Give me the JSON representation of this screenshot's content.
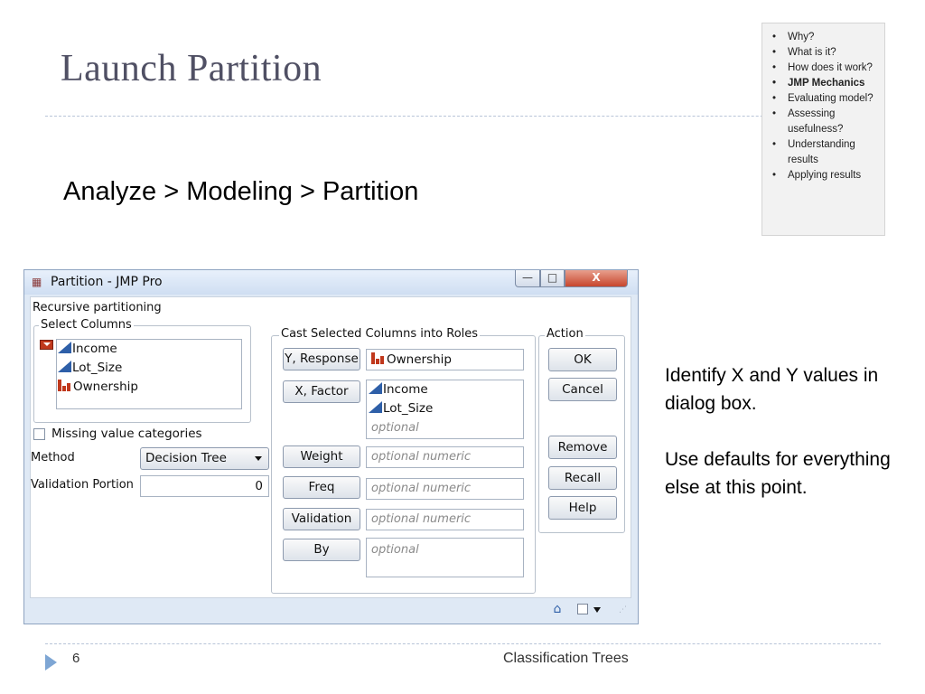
{
  "slide": {
    "title": "Launch Partition",
    "menu_path": "Analyze > Modeling > Partition",
    "notes": [
      "Identify X and Y values in dialog box.",
      "Use defaults for everything else at this point."
    ],
    "page_number": "6",
    "footer_title": "Classification Trees"
  },
  "outline": {
    "items": [
      "Why?",
      "What is it?",
      "How does it work?",
      "JMP Mechanics",
      "Evaluating model?",
      "Assessing usefulness?",
      "Understanding results",
      "Applying results"
    ],
    "active_index": 3
  },
  "dialog": {
    "title": "Partition - JMP Pro",
    "title_buttons": {
      "minimize": "—",
      "maximize": "□",
      "close": "X"
    },
    "heading": "Recursive partitioning",
    "select_columns": {
      "title": "Select Columns",
      "columns": [
        {
          "name": "Income",
          "type": "continuous"
        },
        {
          "name": "Lot_Size",
          "type": "continuous"
        },
        {
          "name": "Ownership",
          "type": "nominal"
        }
      ]
    },
    "missing_value_label": "Missing value categories",
    "missing_value_checked": false,
    "method_label": "Method",
    "method_value": "Decision Tree",
    "validation_portion_label": "Validation Portion",
    "validation_portion_value": "0",
    "cast_roles": {
      "title": "Cast Selected Columns into Roles",
      "y_label": "Y, Response",
      "y_value": "Ownership",
      "x_label": "X, Factor",
      "x_values": [
        "Income",
        "Lot_Size"
      ],
      "x_placeholder": "optional",
      "weight_label": "Weight",
      "weight_placeholder": "optional numeric",
      "freq_label": "Freq",
      "freq_placeholder": "optional numeric",
      "validation_label": "Validation",
      "validation_placeholder": "optional numeric",
      "by_label": "By",
      "by_placeholder": "optional"
    },
    "action": {
      "title": "Action",
      "ok": "OK",
      "cancel": "Cancel",
      "remove": "Remove",
      "recall": "Recall",
      "help": "Help"
    }
  },
  "colors": {
    "title": "#505064",
    "rule": "#b8c4d8",
    "continuous_icon": "#2e5fa8",
    "nominal_icon": "#c0381c",
    "window_frame": "#dfe9f5"
  }
}
